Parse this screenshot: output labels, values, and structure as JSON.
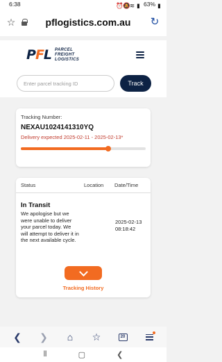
{
  "status_bar": {
    "time": "6:38",
    "battery": "63%"
  },
  "browser": {
    "url": "pflogistics.com.au"
  },
  "site": {
    "logo_mark_p": "P",
    "logo_mark_f": "F",
    "logo_mark_l": "L",
    "logo_line1": "PARCEL",
    "logo_line2": "FREIGHT",
    "logo_line3": "LOGISTICS"
  },
  "search": {
    "placeholder": "Enter parcel tracking ID",
    "button_label": "Track"
  },
  "summary": {
    "label": "Tracking Number:",
    "tracking_number": "NEXAU1024141310YQ",
    "delivery_expected": "Delivery expected 2025-02-11 - 2025-02-13*",
    "progress": 0.7
  },
  "history": {
    "columns": [
      "Status",
      "Location",
      "Date/Time"
    ],
    "events": [
      {
        "status": "In Transit",
        "description": "We apologise but we were unable to deliver your parcel today. We will attempt to deliver it in the next available cycle.",
        "location": "",
        "date": "2025-02-13",
        "time": "08:18:42"
      }
    ],
    "toggle_label": "Tracking History"
  },
  "browser_nav": {
    "tab_count": "20"
  },
  "colors": {
    "accent": "#f26b21",
    "navy": "#0d2244",
    "delivery_text": "#c0392b"
  }
}
